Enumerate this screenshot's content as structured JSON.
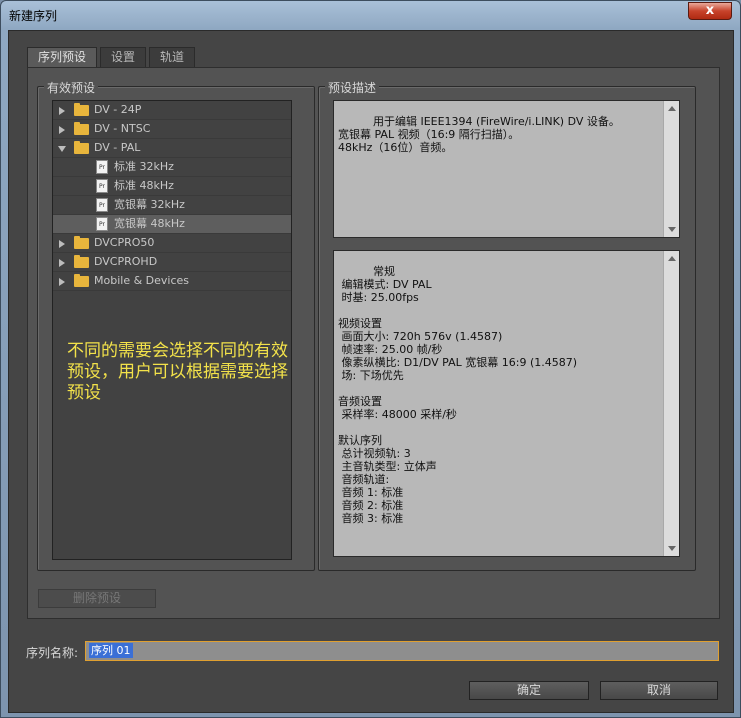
{
  "window": {
    "title": "新建序列",
    "close": "x"
  },
  "tabs": [
    {
      "label": "序列预设"
    },
    {
      "label": "设置"
    },
    {
      "label": "轨道"
    }
  ],
  "presets_group": {
    "title": "有效预设"
  },
  "description_group": {
    "title": "预设描述"
  },
  "tree": {
    "folders": {
      "dv24p": "DV - 24P",
      "dvntsc": "DV - NTSC",
      "dvpal": "DV - PAL",
      "dvcpro50": "DVCPRO50",
      "dvcprohd": "DVCPROHD",
      "mobile": "Mobile & Devices"
    },
    "pal_presets": [
      {
        "label": "标准 32kHz"
      },
      {
        "label": "标准 48kHz"
      },
      {
        "label": "宽银幕 32kHz"
      },
      {
        "label": "宽银幕 48kHz"
      }
    ],
    "preset_icon_text": "Pr"
  },
  "annotation": "不同的需要会选择不同的有效预设，用户可以根据需要选择预设",
  "description_text": "用于编辑 IEEE1394 (FireWire/i.LINK) DV 设备。\n宽银幕 PAL 视频（16:9 隔行扫描）。\n48kHz（16位）音频。",
  "details_text": "常规\n 编辑模式: DV PAL\n 时基: 25.00fps\n\n视频设置\n 画面大小: 720h 576v (1.4587)\n 帧速率: 25.00 帧/秒\n 像素纵横比: D1/DV PAL 宽银幕 16:9 (1.4587)\n 场: 下场优先\n\n音频设置\n 采样率: 48000 采样/秒\n\n默认序列\n 总计视频轨: 3\n 主音轨类型: 立体声\n 音频轨道:\n 音频 1: 标准\n 音频 2: 标准\n 音频 3: 标准",
  "delete_button": "删除预设",
  "sequence_name": {
    "label": "序列名称:",
    "value": "序列 01"
  },
  "ok_button": "确定",
  "cancel_button": "取消"
}
